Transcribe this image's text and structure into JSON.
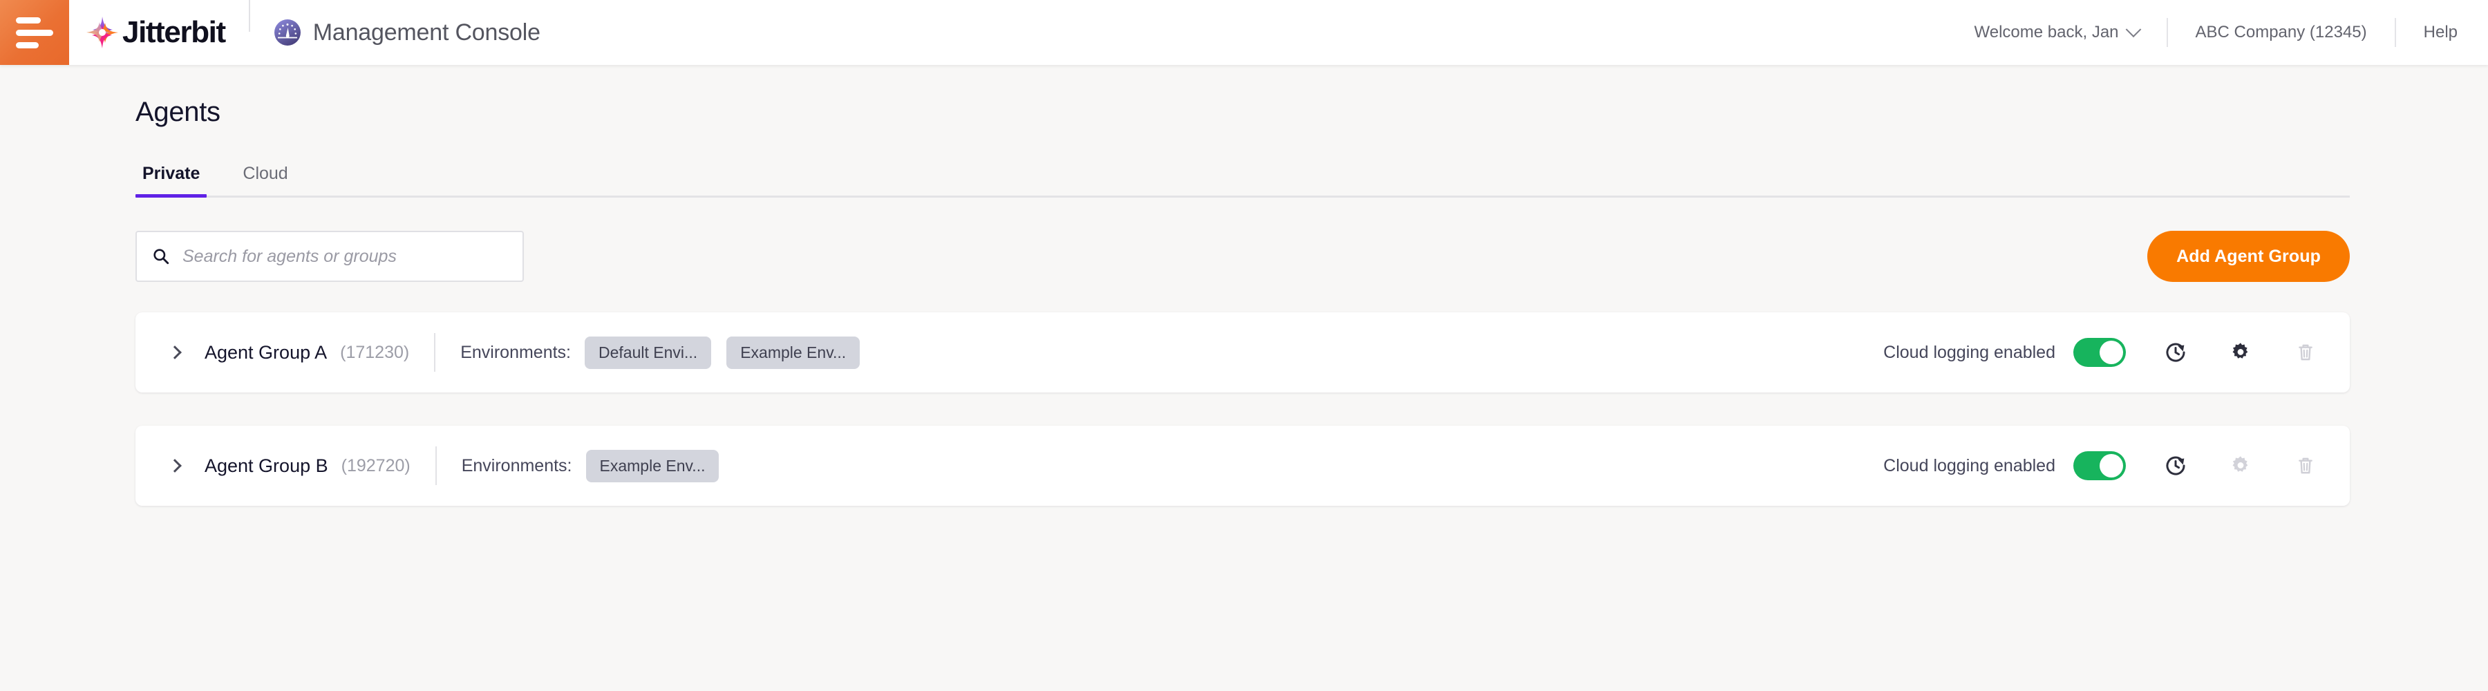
{
  "header": {
    "menu_icon": "hamburger-menu-icon",
    "brand": "Jitterbit",
    "brand_logo_icon": "jitterbit-star-logo-icon",
    "console_icon": "gauge-icon",
    "console_title": "Management Console",
    "welcome": "Welcome back, Jan",
    "welcome_chevron_icon": "chevron-down-icon",
    "company": "ABC Company (12345)",
    "help": "Help"
  },
  "page": {
    "title": "Agents"
  },
  "tabs": [
    {
      "label": "Private",
      "active": true
    },
    {
      "label": "Cloud",
      "active": false
    }
  ],
  "toolbar": {
    "search_icon": "search-icon",
    "search_value": "",
    "search_placeholder": "Search for agents or groups",
    "add_button_label": "Add Agent Group"
  },
  "groups": [
    {
      "expand_icon": "chevron-right-icon",
      "name": "Agent Group A",
      "id": "(171230)",
      "env_label": "Environments:",
      "environments": [
        "Default Envi...",
        "Example Env..."
      ],
      "logging_label": "Cloud logging enabled",
      "logging_enabled": true,
      "actions": [
        {
          "icon": "restart-clock-icon",
          "disabled": false
        },
        {
          "icon": "gear-icon",
          "disabled": false
        },
        {
          "icon": "trash-icon",
          "disabled": true
        }
      ]
    },
    {
      "expand_icon": "chevron-right-icon",
      "name": "Agent Group B",
      "id": "(192720)",
      "env_label": "Environments:",
      "environments": [
        "Example Env..."
      ],
      "logging_label": "Cloud logging enabled",
      "logging_enabled": true,
      "actions": [
        {
          "icon": "restart-clock-icon",
          "disabled": false
        },
        {
          "icon": "gear-icon",
          "disabled": true
        },
        {
          "icon": "trash-icon",
          "disabled": true
        }
      ]
    }
  ],
  "colors": {
    "accent_orange": "#f97a00",
    "menu_orange": "#ea7033",
    "tab_active_purple": "#6021e6",
    "toggle_green": "#17b45d",
    "page_background": "#f8f7f6",
    "chip_background": "#d3d5dd"
  }
}
